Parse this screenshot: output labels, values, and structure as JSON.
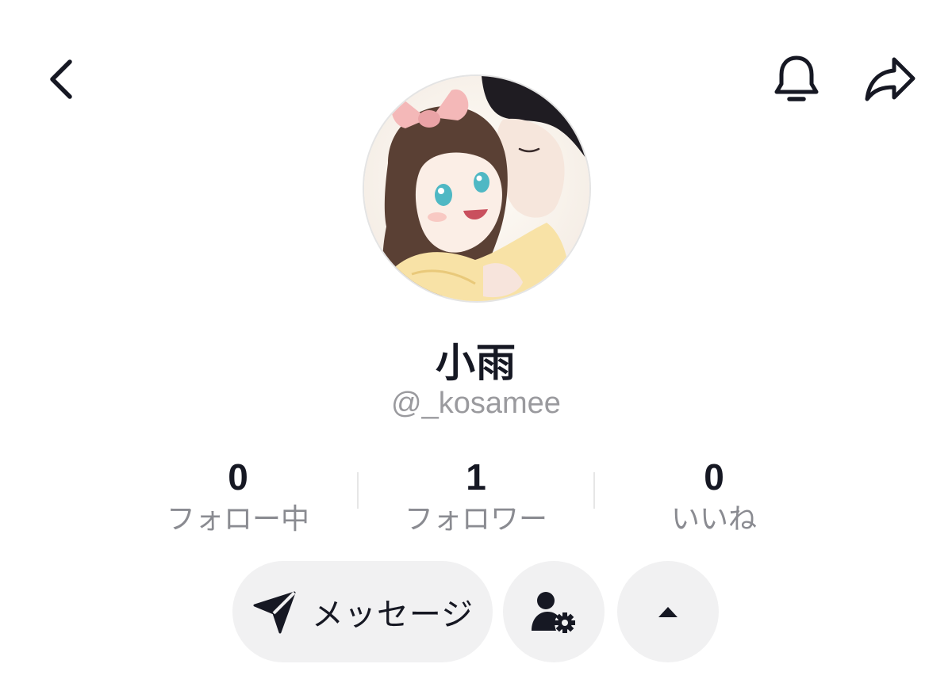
{
  "header": {
    "back_icon": "chevron-left-icon",
    "bell_icon": "bell-icon",
    "share_icon": "share-arrow-icon"
  },
  "profile": {
    "avatar_description": "anime-couple-avatar",
    "display_name": "小雨",
    "handle": "@_kosamee"
  },
  "stats": [
    {
      "value": "0",
      "label": "フォロー中"
    },
    {
      "value": "1",
      "label": "フォロワー"
    },
    {
      "value": "0",
      "label": "いいね"
    }
  ],
  "actions": {
    "message_label": "メッセージ",
    "message_icon": "send-icon",
    "user_settings_icon": "user-gear-icon",
    "expand_icon": "caret-up-icon"
  },
  "colors": {
    "text_primary": "#161823",
    "text_secondary": "#8a8b91",
    "button_bg": "#f1f1f2"
  }
}
